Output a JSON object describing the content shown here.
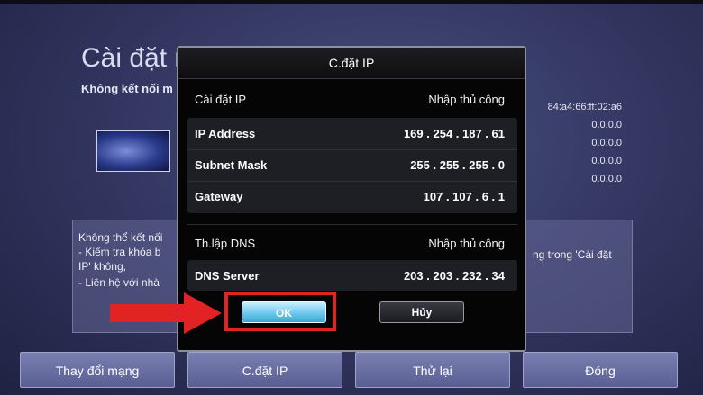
{
  "background": {
    "title": "Cài đặt m",
    "subtitle": "Không kết nối m",
    "mac_values": [
      "84:a4:66:ff:02:a6",
      "0.0.0.0",
      "0.0.0.0",
      "0.0.0.0",
      "0.0.0.0"
    ],
    "error_lines": {
      "line1": "Không thể kết nối",
      "line2": "- Kiểm tra khóa b",
      "line3": "IP' không,",
      "line4": "- Liên hệ với nhà",
      "right_fragment": "ng trong 'Cài đặt"
    }
  },
  "bottom_bar": {
    "change_network": "Thay đổi mạng",
    "ip_settings": "C.đặt IP",
    "retry": "Thử lại",
    "close": "Đóng"
  },
  "dialog": {
    "title": "C.đặt IP",
    "ip_setting": {
      "label": "Cài đặt IP",
      "value": "Nhập thủ công"
    },
    "ip_address": {
      "label": "IP Address",
      "value": "169 . 254 . 187 . 61"
    },
    "subnet_mask": {
      "label": "Subnet Mask",
      "value": "255 . 255 . 255 . 0"
    },
    "gateway": {
      "label": "Gateway",
      "value": "107 . 107 . 6 . 1"
    },
    "dns_setting": {
      "label": "Th.lập DNS",
      "value": "Nhập thủ công"
    },
    "dns_server": {
      "label": "DNS Server",
      "value": "203 . 203 . 232 . 34"
    },
    "ok_label": "OK",
    "cancel_label": "Hủy"
  },
  "annotation": {
    "highlight_color": "#e32224",
    "arrow_color": "#e32224"
  }
}
